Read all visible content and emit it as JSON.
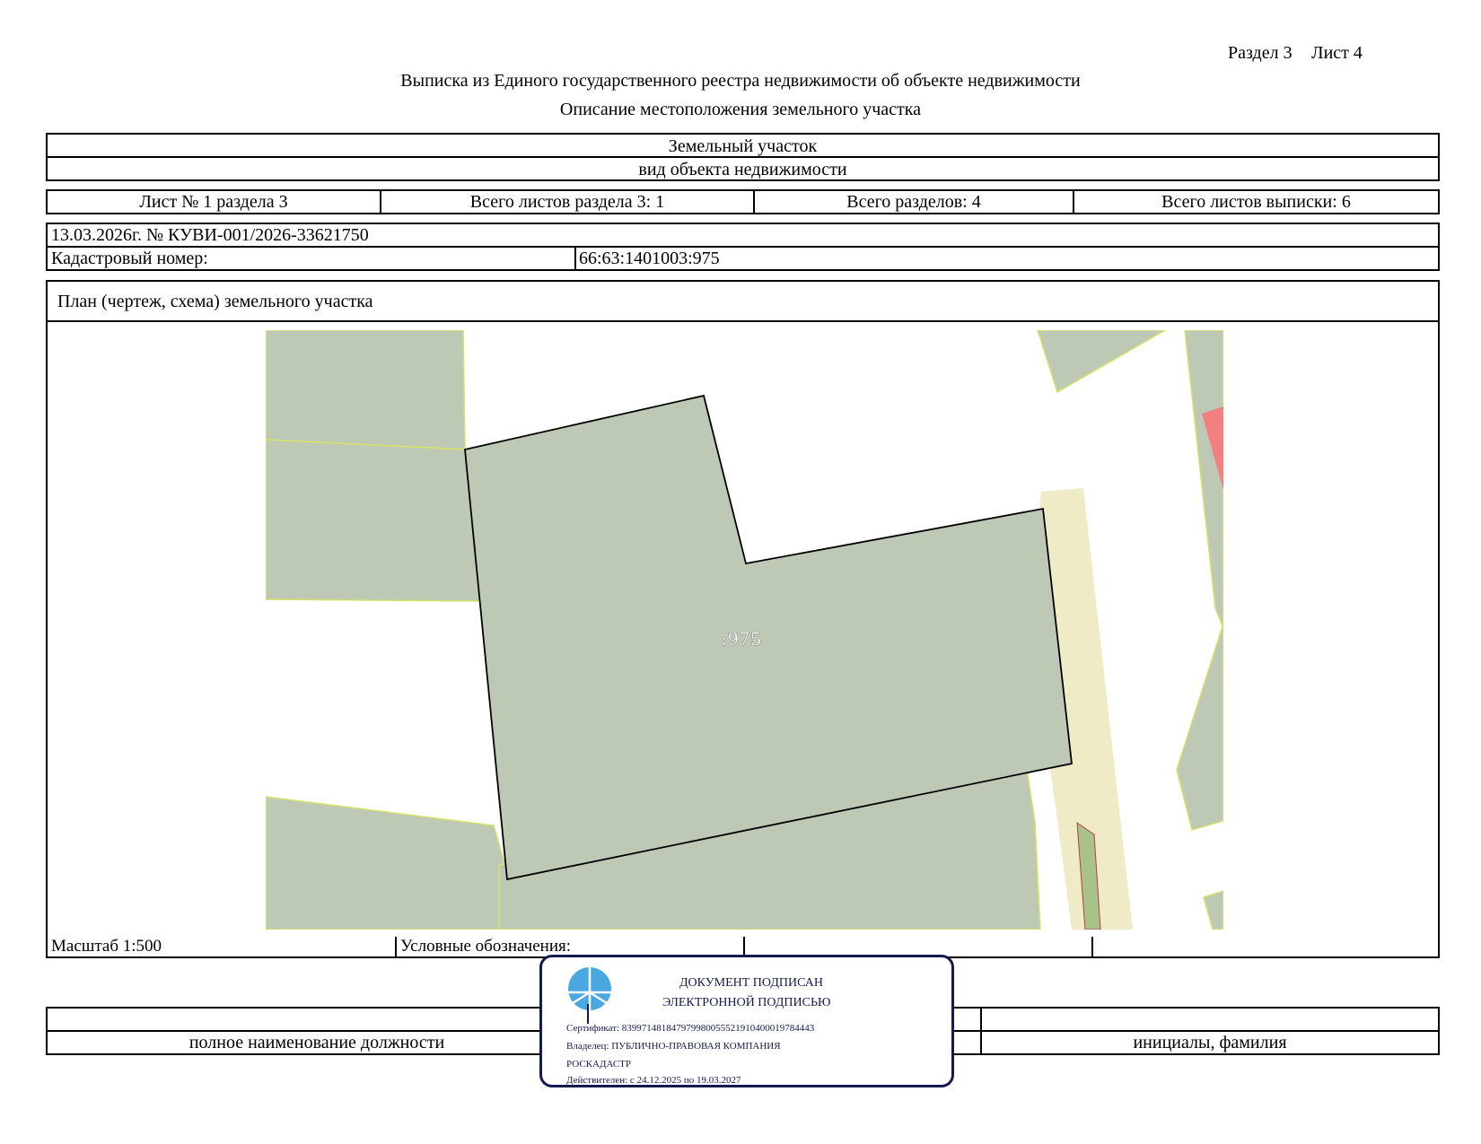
{
  "header": {
    "section": "Раздел 3",
    "sheet": "Лист 4",
    "title": "Выписка из Единого государственного реестра недвижимости об объекте недвижимости",
    "subtitle": "Описание местоположения земельного участка"
  },
  "object": {
    "type_value": "Земельный участок",
    "type_caption": "вид объекта недвижимости"
  },
  "sheets_row": {
    "sheet_no": "Лист № 1 раздела 3",
    "sheets_in_section": "Всего листов раздела 3: 1",
    "sections_total": "Всего разделов: 4",
    "sheets_total": "Всего листов выписки: 6"
  },
  "record": {
    "date_number": "13.03.2026г. № КУВИ-001/2026-33621750",
    "cadastral_label": "Кадастровый номер:",
    "cadastral_value": "66:63:1401003:975"
  },
  "plan": {
    "title": "План (чертеж, схема) земельного участка",
    "parcel_label": ":975",
    "colors": {
      "parcel_fill": "#bdc9b4",
      "road_fill": "#efebc6",
      "neighbor_border": "#d6e26a",
      "highlight": "#f28080",
      "small_strip": "#a9c28a"
    }
  },
  "legend_row": {
    "scale": "Масштаб 1:500",
    "legend_label": "Условные обозначения:",
    "cell3": "",
    "cell4": ""
  },
  "signature": {
    "position_caption": "полное наименование должности",
    "name_caption": "инициалы, фамилия"
  },
  "stamp": {
    "line1": "ДОКУМЕНТ ПОДПИСАН",
    "line2": "ЭЛЕКТРОННОЙ ПОДПИСЬЮ",
    "certificate": "Сертификат: 839971481847979980055521910400019784443",
    "owner1": "Владелец: ПУБЛИЧНО-ПРАВОВАЯ КОМПАНИЯ",
    "owner2": "РОСКАДАСТР",
    "valid": "Действителен: с 24.12.2025 по 19.03.2027",
    "border_color": "#141a4e",
    "logo_color": "#4aa8e0"
  }
}
